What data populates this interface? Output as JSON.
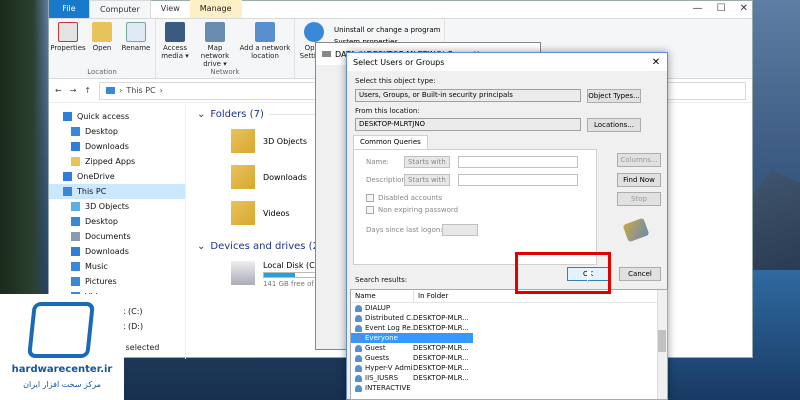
{
  "explorer": {
    "tabs": [
      "File",
      "Computer",
      "View",
      "Manage"
    ],
    "ribbon": {
      "location_buttons": [
        "Properties",
        "Open",
        "Rename"
      ],
      "location_label": "Location",
      "network_buttons": [
        "Access media ▾",
        "Map network drive ▾",
        "Add a network location"
      ],
      "network_label": "Network",
      "open_settings": "Open Settings",
      "system_items": [
        "Uninstall or change a program",
        "System properties"
      ]
    },
    "address": "This PC",
    "nav": [
      {
        "label": "Quick access",
        "icon": "star-icon",
        "color": "#2f7fd8"
      },
      {
        "label": "Desktop",
        "icon": "desktop-icon",
        "color": "#3a88d8"
      },
      {
        "label": "Downloads",
        "icon": "download-icon",
        "color": "#2f7fd8"
      },
      {
        "label": "Zipped Apps",
        "icon": "folder-icon",
        "color": "#e8c25a"
      },
      {
        "label": "OneDrive",
        "icon": "cloud-icon",
        "color": "#2f7fd8"
      },
      {
        "label": "This PC",
        "icon": "pc-icon",
        "color": "#3a88d8"
      },
      {
        "label": "3D Objects",
        "icon": "cube-icon",
        "color": "#5ab0e0"
      },
      {
        "label": "Desktop",
        "icon": "desktop-icon",
        "color": "#3a88d8"
      },
      {
        "label": "Documents",
        "icon": "document-icon",
        "color": "#8a9ab0"
      },
      {
        "label": "Downloads",
        "icon": "download-icon",
        "color": "#2f7fd8"
      },
      {
        "label": "Music",
        "icon": "music-icon",
        "color": "#3a88d8"
      },
      {
        "label": "Pictures",
        "icon": "picture-icon",
        "color": "#3a88d8"
      },
      {
        "label": "Videos",
        "icon": "video-icon",
        "color": "#3a88d8"
      },
      {
        "label": "Local Disk (C:)",
        "icon": "disk-icon",
        "color": "#8a9ab0"
      },
      {
        "label": "Local Disk (D:)",
        "icon": "disk-icon",
        "color": "#8a9ab0"
      }
    ],
    "folders_header": "Folders (7)",
    "folders": [
      "3D Objects",
      "Downloads",
      "Videos"
    ],
    "drives_header": "Devices and drives (2)",
    "drive_name": "Local Disk (C:)",
    "drive_free": "141 GB free of 2",
    "drive_usage": 0.4,
    "status": "item selected"
  },
  "props": {
    "title": "DATA (\\\\DESKTOP-MLRTJNO) Properties"
  },
  "dialog": {
    "title": "Select Users or Groups",
    "object_type_label": "Select this object type:",
    "object_type_value": "Users, Groups, or Built-in security principals",
    "object_types_button": "Object Types...",
    "location_label": "From this location:",
    "location_value": "DESKTOP-MLRTJNO",
    "locations_button": "Locations...",
    "tab": "Common Queries",
    "name_label": "Name:",
    "desc_label": "Description:",
    "starts_with": "Starts with",
    "disabled_accounts": "Disabled accounts",
    "non_expiring": "Non expiring password",
    "days_label": "Days since last logon:",
    "columns_button": "Columns...",
    "find_now_button": "Find Now",
    "stop_button": "Stop",
    "ok_button": "OK",
    "cancel_button": "Cancel",
    "results_label": "Search results:",
    "col_name": "Name",
    "col_folder": "In Folder",
    "results": [
      {
        "name": "DIALUP",
        "folder": ""
      },
      {
        "name": "Distributed C...",
        "folder": "DESKTOP-MLR..."
      },
      {
        "name": "Event Log Re...",
        "folder": "DESKTOP-MLR..."
      },
      {
        "name": "Everyone",
        "folder": ""
      },
      {
        "name": "Guest",
        "folder": "DESKTOP-MLR..."
      },
      {
        "name": "Guests",
        "folder": "DESKTOP-MLR..."
      },
      {
        "name": "Hyper-V Admi...",
        "folder": "DESKTOP-MLR..."
      },
      {
        "name": "IIS_IUSRS",
        "folder": "DESKTOP-MLR..."
      },
      {
        "name": "INTERACTIVE",
        "folder": ""
      }
    ],
    "selected_index": 3
  },
  "logo": {
    "brand": "hardwarecenter.ir",
    "tagline": "مرکز سخت افزار ایران"
  }
}
